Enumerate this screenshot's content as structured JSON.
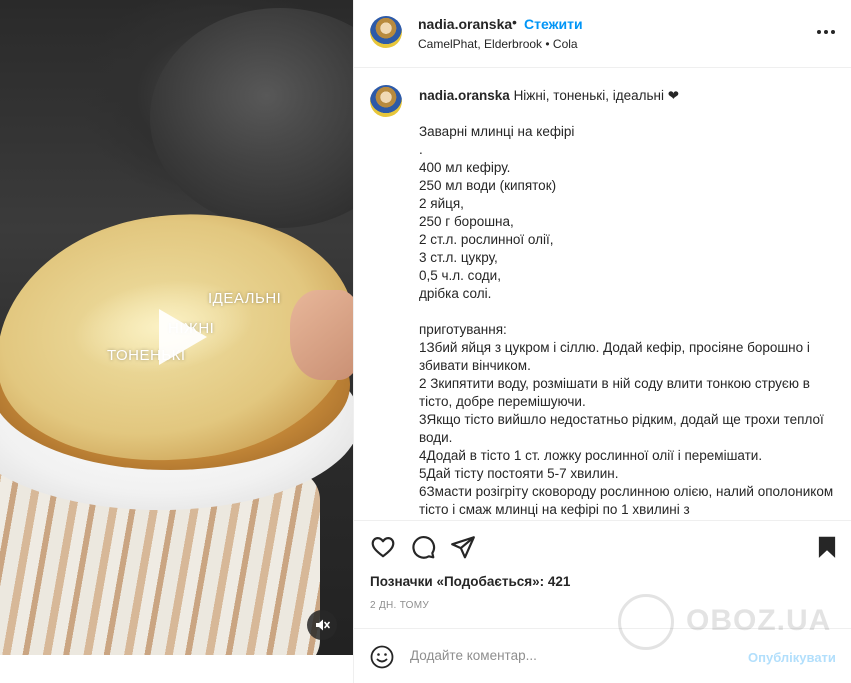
{
  "post": {
    "username": "nadia.oranska",
    "separator": "•",
    "follow_label": "Стежити",
    "audio": "CamelPhat, Elderbrook • Cola",
    "likes": "Позначки «Подобається»: 421",
    "timestamp": "2 ДН. ТОМУ"
  },
  "video": {
    "overlay_text": [
      "ІДЕАЛЬНІ",
      "НІЖНІ",
      "ТОНЕНЬКІ"
    ],
    "play_icon": "play-icon",
    "mute_icon": "speaker-muted-icon"
  },
  "caption": {
    "username": "nadia.oranska",
    "first_line": "Ніжні, тоненькі, ідеальні ❤",
    "lines": [
      "Заварні млинці на кефірі",
      ".",
      "400 мл кефіру.",
      "250 мл води (кипяток)",
      "2 яйця,",
      "250 г борошна,",
      "2 ст.л. рослинної олії,",
      "3 ст.л. цукру,",
      "0,5 ч.л. соди,",
      "дрібка солі.",
      "",
      "приготування:",
      "1Збий яйця з цукром і сіллю. Додай кефір, просіяне борошно і збивати вінчиком.",
      "2 Зкипятити воду, розмішати в ній соду влити тонкою струєю в тісто, добре перемішуючи.",
      "3Якщо тісто вийшло недостатньо рідким, додай ще трохи теплої води.",
      "4Додай в тісто 1 ст. ложку рослинної олії і перемішати.",
      "5Дай тісту постояти 5-7 хвилин.",
      "6Змасти розігріту сковороду рослинною олією, налий ополоником тісто і смаж млинці на кефірі по 1 хвилині з"
    ]
  },
  "actions": {
    "like_icon": "heart-icon",
    "comment_icon": "comment-icon",
    "share_icon": "paper-plane-icon",
    "save_icon": "bookmark-icon"
  },
  "comment": {
    "placeholder": "Додайте коментар...",
    "publish_label": "Опублікувати",
    "emoji_icon": "emoji-icon"
  },
  "watermark": {
    "text": "OBOZ.UA"
  },
  "colors": {
    "accent": "#0095f6",
    "publish_disabled": "#b2dffc",
    "muted_text": "#8e8e8e"
  }
}
